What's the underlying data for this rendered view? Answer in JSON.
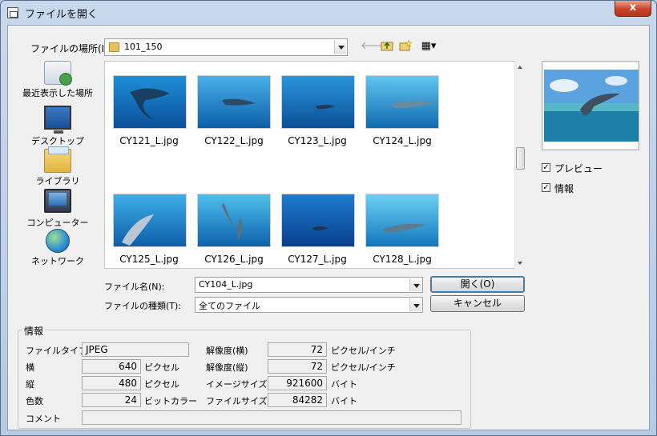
{
  "window": {
    "title": "ファイルを開く",
    "close_glyph": "x"
  },
  "location": {
    "label": "ファイルの場所(I):",
    "value": "101_150"
  },
  "toolbar": {
    "back_glyph": "🡐",
    "view_glyph": "▦▾"
  },
  "places": [
    {
      "label": "最近表示した場所",
      "icon": "recent-places-icon"
    },
    {
      "label": "デスクトップ",
      "icon": "desktop-icon"
    },
    {
      "label": "ライブラリ",
      "icon": "library-icon"
    },
    {
      "label": "コンピューター",
      "icon": "computer-icon"
    },
    {
      "label": "ネットワーク",
      "icon": "network-icon"
    }
  ],
  "files": [
    {
      "name": "CY121_L.jpg"
    },
    {
      "name": "CY122_L.jpg"
    },
    {
      "name": "CY123_L.jpg"
    },
    {
      "name": "CY124_L.jpg"
    },
    {
      "name": "CY125_L.jpg"
    },
    {
      "name": "CY126_L.jpg"
    },
    {
      "name": "CY127_L.jpg"
    },
    {
      "name": "CY128_L.jpg"
    }
  ],
  "preview": {
    "checkbox_label": "プレビュー",
    "checked": true
  },
  "info_toggle": {
    "checkbox_label": "情報",
    "checked": true
  },
  "check_glyph": "✓",
  "filename": {
    "label": "ファイル名(N):",
    "value": "CY104_L.jpg"
  },
  "filetype": {
    "label": "ファイルの種類(T):",
    "value": "全てのファイル"
  },
  "buttons": {
    "open": "開く(O)",
    "cancel": "キャンセル"
  },
  "info": {
    "title": "情報",
    "filetype_label": "ファイルタイプ",
    "filetype_value": "JPEG",
    "width_label": "横",
    "width_value": "640",
    "width_unit": "ピクセル",
    "height_label": "縦",
    "height_value": "480",
    "height_unit": "ピクセル",
    "colors_label": "色数",
    "colors_value": "24",
    "colors_unit": "ビットカラー",
    "comment_label": "コメント",
    "comment_value": "",
    "hres_label": "解像度(横)",
    "hres_value": "72",
    "hres_unit": "ピクセル/インチ",
    "vres_label": "解像度(縦)",
    "vres_value": "72",
    "vres_unit": "ピクセル/インチ",
    "imgsize_label": "イメージサイズ",
    "imgsize_value": "921600",
    "imgsize_unit": "バイト",
    "filesize_label": "ファイルサイズ",
    "filesize_value": "84282",
    "filesize_unit": "バイト"
  }
}
